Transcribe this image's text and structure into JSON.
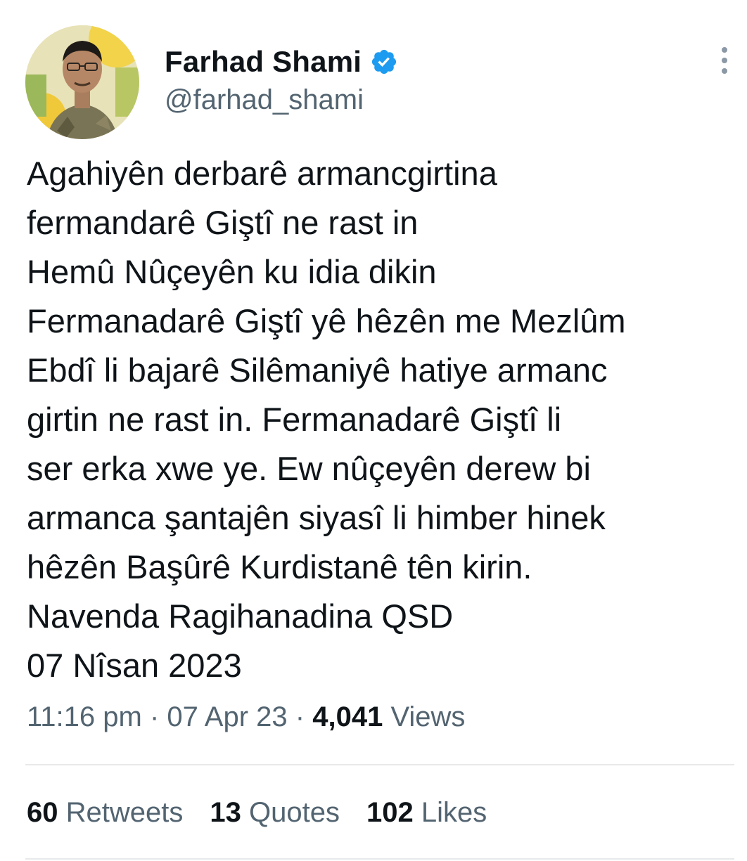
{
  "author": {
    "display_name": "Farhad Shami",
    "handle": "@farhad_shami",
    "verified": true
  },
  "tweet": {
    "lines": [
      "Agahiyên derbarê armancgirtina",
      "fermandarê Giştî ne rast in",
      "Hemû Nûçeyên ku idia dikin",
      "Fermanadarê Giştî yê hêzên me Mezlûm",
      "Ebdî li bajarê Silêmaniyê hatiye armanc",
      "girtin ne rast in. Fermanadarê Giştî li",
      "ser erka xwe ye. Ew nûçeyên derew bi",
      "armanca şantajên siyasî li himber hinek",
      "hêzên Başûrê Kurdistanê tên kirin.",
      "Navenda Ragihanadina QSD",
      "07 Nîsan 2023"
    ]
  },
  "meta": {
    "time": "11:16 pm",
    "separator": "·",
    "date": "07 Apr 23",
    "views_count": "4,041",
    "views_label": "Views"
  },
  "stats": {
    "retweets_count": "60",
    "retweets_label": "Retweets",
    "quotes_count": "13",
    "quotes_label": "Quotes",
    "likes_count": "102",
    "likes_label": "Likes"
  },
  "colors": {
    "text_primary": "#0f1419",
    "text_secondary": "#536471",
    "verified_blue": "#1d9bf0",
    "divider": "#e7e9ea"
  },
  "icons": {
    "verified": "verified-badge-icon",
    "more": "more-vertical-icon"
  }
}
